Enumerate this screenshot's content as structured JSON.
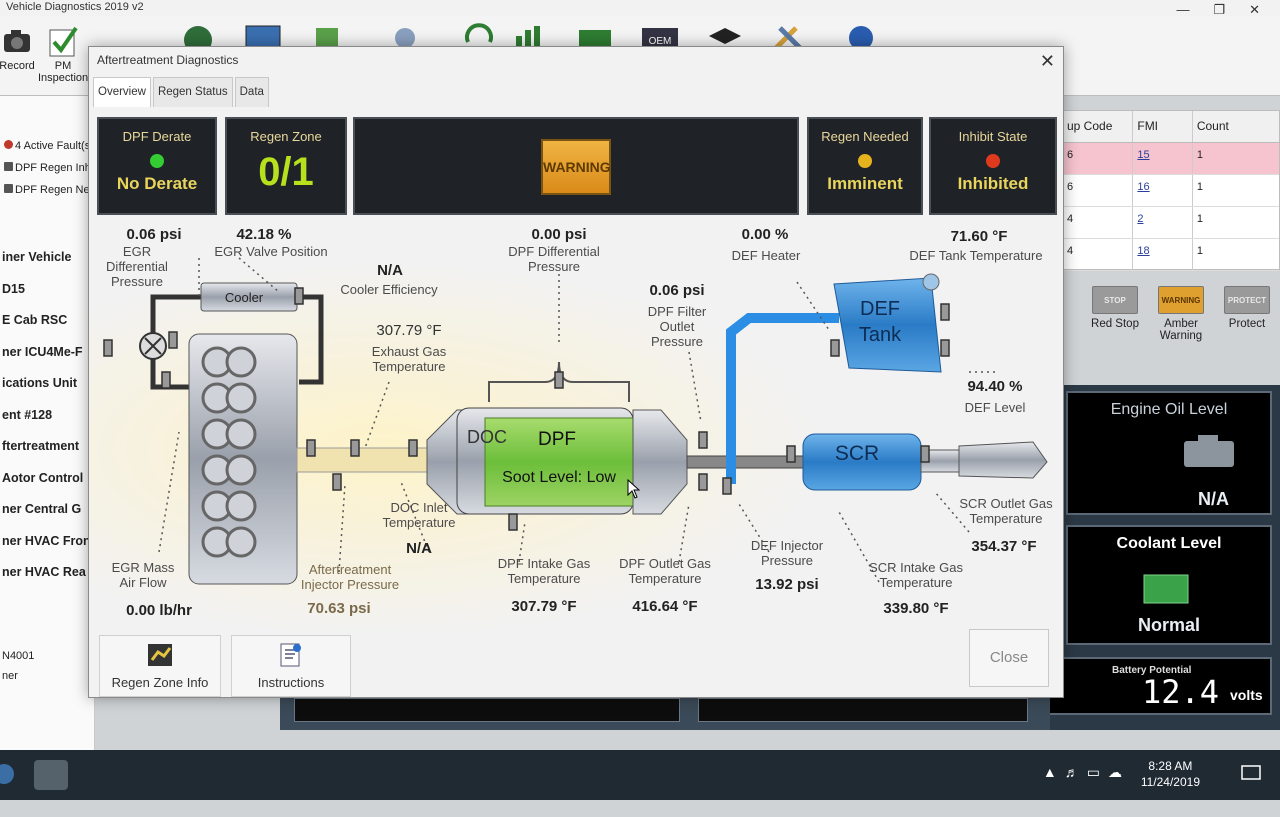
{
  "app": {
    "title": "Vehicle Diagnostics 2019 v2",
    "toolbar": [
      {
        "label": "Record",
        "icon": "camera-icon"
      },
      {
        "label": "PM Inspection",
        "icon": "checkmark-icon"
      }
    ]
  },
  "sidebar": {
    "faults": [
      "4 Active Fault(s)",
      "DPF Regen Inhibit",
      "DPF Regen Needed"
    ],
    "items": [
      "iner Vehicle",
      "D15",
      "E Cab RSC",
      "ner ICU4Me-F",
      "ications Unit",
      "ent #128",
      "ftertreatment",
      "Aotor Control",
      "ner Central G",
      "ner HVAC Fron",
      "ner HVAC Rea"
    ],
    "bottom": [
      "N4001",
      "ner"
    ]
  },
  "fault_table": {
    "headers": [
      "up Code",
      "FMI",
      "Count"
    ],
    "rows": [
      {
        "code": "6",
        "fmi": "15",
        "count": "1"
      },
      {
        "code": "6",
        "fmi": "16",
        "count": "1"
      },
      {
        "code": "4",
        "fmi": "2",
        "count": "1"
      },
      {
        "code": "4",
        "fmi": "18",
        "count": "1"
      }
    ]
  },
  "lamps": {
    "red_stop": {
      "chip": "STOP",
      "label": "Red Stop"
    },
    "amber": {
      "chip": "WARNING",
      "label": "Amber Warning"
    },
    "protect": {
      "chip": "PROTECT",
      "label": "Protect"
    }
  },
  "gauges": {
    "engine_oil": {
      "title": "Engine Oil Level",
      "value": "N/A"
    },
    "coolant": {
      "title": "Coolant Level",
      "value": "Normal"
    },
    "battery": {
      "title": "Battery Potential",
      "value": "12.4",
      "unit": "volts"
    }
  },
  "taskbar": {
    "time": "8:28 AM",
    "date": "11/24/2019"
  },
  "dialog": {
    "title": "Aftertreatment Diagnostics",
    "tabs": [
      "Overview",
      "Regen Status",
      "Data"
    ],
    "status": {
      "dpf_derate": {
        "label": "DPF Derate",
        "value": "No Derate",
        "led_color": "#33cc33"
      },
      "regen_zone": {
        "label": "Regen Zone",
        "value": "0/1"
      },
      "warning": "WARNING",
      "regen_needed": {
        "label": "Regen Needed",
        "value": "Imminent",
        "led_color": "#e6b31e"
      },
      "inhibit_state": {
        "label": "Inhibit State",
        "value": "Inhibited",
        "led_color": "#e03a1e"
      }
    },
    "diagram": {
      "egr_diff_pressure": {
        "label": "EGR Differential Pressure",
        "value": "0.06 psi"
      },
      "egr_valve_position": {
        "label": "EGR Valve Position",
        "value": "42.18 %"
      },
      "cooler_label": "Cooler",
      "cooler_efficiency": {
        "label": "Cooler Efficiency",
        "value": "N/A"
      },
      "exhaust_gas_temp": {
        "label": "Exhaust Gas Temperature",
        "value": "307.79 °F"
      },
      "dpf_diff_pressure": {
        "label": "DPF Differential Pressure",
        "value": "0.00 psi"
      },
      "dpf_filter_outlet_pressure": {
        "label": "DPF Filter Outlet Pressure",
        "value": "0.06 psi"
      },
      "def_heater": {
        "label": "DEF Heater",
        "value": "0.00 %"
      },
      "def_tank_temp": {
        "label": "DEF Tank Temperature",
        "value": "71.60 °F"
      },
      "def_tank_label": "DEF Tank",
      "def_level": {
        "label": "DEF Level",
        "value": "94.40 %"
      },
      "doc_label": "DOC",
      "dpf_label": "DPF",
      "soot_level": "Soot Level: Low",
      "scr_label": "SCR",
      "doc_inlet_temp": {
        "label": "DOC Inlet Temperature",
        "value": "N/A"
      },
      "egr_mass_air_flow": {
        "label": "EGR Mass Air Flow",
        "value": "0.00 lb/hr"
      },
      "aftertreatment_injector_pressure": {
        "label": "Aftertreatment Injector Pressure",
        "value": "70.63 psi"
      },
      "dpf_intake_gas_temp": {
        "label": "DPF Intake Gas Temperature",
        "value": "307.79 °F"
      },
      "dpf_outlet_gas_temp": {
        "label": "DPF Outlet Gas Temperature",
        "value": "416.64 °F"
      },
      "def_injector_pressure": {
        "label": "DEF Injector Pressure",
        "value": "13.92 psi"
      },
      "scr_intake_gas_temp": {
        "label": "SCR Intake Gas Temperature",
        "value": "339.80 °F"
      },
      "scr_outlet_gas_temp": {
        "label": "SCR Outlet Gas Temperature",
        "value": "354.37 °F"
      }
    },
    "buttons": {
      "regen_zone_info": "Regen Zone Info",
      "instructions": "Instructions",
      "close": "Close"
    }
  }
}
